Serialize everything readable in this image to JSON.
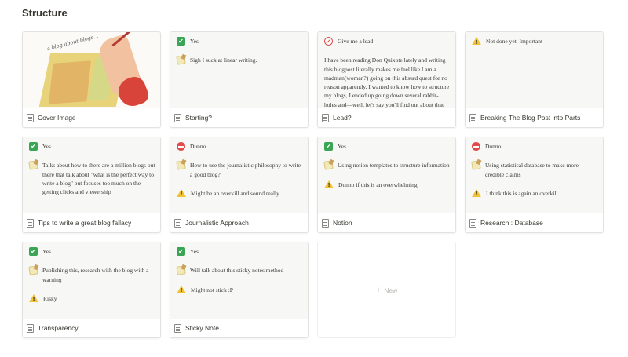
{
  "board": {
    "title": "Structure"
  },
  "cover_scribble": "a blog about blogs...",
  "cards": [
    {
      "title": "Cover Image"
    },
    {
      "title": "Starting?",
      "lines": [
        {
          "icon": "check",
          "text": "Yes"
        },
        {
          "icon": "memo",
          "text": "Sigh I suck at linear writing."
        }
      ]
    },
    {
      "title": "Lead?",
      "lines": [
        {
          "icon": "prohibit",
          "text": "Give me a lead"
        },
        {
          "icon": "none",
          "text": "I have been reading Don Quixote lately and writing this blogpost literally makes me feel like I am a madman(woman?) going on this absurd quest for no reason apparently. I wanted to know how to structure my blogs, I ended up going down several rabbit-holes and—well, let's say you'll find out about that"
        }
      ]
    },
    {
      "title": "Breaking The Blog Post into Parts",
      "lines": [
        {
          "icon": "warn",
          "text": "Not done yet. Important"
        }
      ]
    },
    {
      "title": "Tips to write a great blog fallacy",
      "lines": [
        {
          "icon": "check",
          "text": "Yes"
        },
        {
          "icon": "memo",
          "text": "Talks about how to there are a million blogs out there that talk about \"what is the perfect way to write a blog\" but focuses too much on the getting clicks and viewership"
        }
      ]
    },
    {
      "title": "Journalistic Approach",
      "lines": [
        {
          "icon": "noentry",
          "text": "Dunno"
        },
        {
          "icon": "memo",
          "text": "How to use the journalistic philosophy to write a good blog?"
        },
        {
          "icon": "warn",
          "text": "Might be an overkill and sound really"
        }
      ]
    },
    {
      "title": "Notion",
      "lines": [
        {
          "icon": "check",
          "text": "Yes"
        },
        {
          "icon": "memo",
          "text": "Using notion templates to structure information"
        },
        {
          "icon": "warn",
          "text": "Dunno if this is an overwhelming"
        }
      ]
    },
    {
      "title": "Research : Database",
      "lines": [
        {
          "icon": "noentry",
          "text": "Dunno"
        },
        {
          "icon": "memo",
          "text": "Using statistical database to make more credible claims"
        },
        {
          "icon": "warn",
          "text": "I think this is again an overkill"
        }
      ]
    },
    {
      "title": "Transparency",
      "lines": [
        {
          "icon": "check",
          "text": "Yes"
        },
        {
          "icon": "memo",
          "text": "Publishing this, research with the blog with a warning"
        },
        {
          "icon": "warn",
          "text": "Risky"
        }
      ]
    },
    {
      "title": "Sticky Note",
      "lines": [
        {
          "icon": "check",
          "text": "Yes"
        },
        {
          "icon": "memo",
          "text": "Will talk about this sticky notes method"
        },
        {
          "icon": "warn",
          "text": "Might not stick :P"
        }
      ]
    }
  ],
  "new_card": {
    "label": "New"
  },
  "colors": {
    "check": "#3aa655",
    "noentry": "#e24b4b",
    "warn": "#f2c230",
    "border": "#e2e2e0"
  }
}
